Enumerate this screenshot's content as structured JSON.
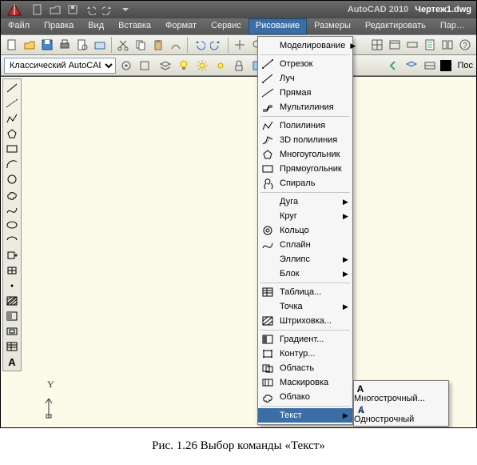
{
  "app": {
    "name": "AutoCAD 2010",
    "filename": "Чертеж1.dwg"
  },
  "menubar": {
    "items": [
      "Файл",
      "Правка",
      "Вид",
      "Вставка",
      "Формат",
      "Сервис",
      "Рисование",
      "Размеры",
      "Редактировать",
      "Параметриза"
    ]
  },
  "workspace": {
    "selected": "Классический AutoCAD"
  },
  "rightlabel": "Пос",
  "dropdown": {
    "groups": [
      [
        {
          "label": "Моделирование",
          "sub": true
        }
      ],
      [
        {
          "label": "Отрезок"
        },
        {
          "label": "Луч"
        },
        {
          "label": "Прямая"
        },
        {
          "label": "Мультилиния"
        }
      ],
      [
        {
          "label": "Полилиния"
        },
        {
          "label": "3D полилиния"
        },
        {
          "label": "Многоугольник"
        },
        {
          "label": "Прямоугольник"
        },
        {
          "label": "Спираль"
        }
      ],
      [
        {
          "label": "Дуга",
          "sub": true
        },
        {
          "label": "Круг",
          "sub": true
        },
        {
          "label": "Кольцо"
        },
        {
          "label": "Сплайн"
        },
        {
          "label": "Эллипс",
          "sub": true
        },
        {
          "label": "Блок",
          "sub": true
        }
      ],
      [
        {
          "label": "Таблица..."
        },
        {
          "label": "Точка",
          "sub": true
        },
        {
          "label": "Штриховка..."
        }
      ],
      [
        {
          "label": "Градиент..."
        },
        {
          "label": "Контур..."
        },
        {
          "label": "Область"
        },
        {
          "label": "Маскировка"
        },
        {
          "label": "Облако"
        }
      ],
      [
        {
          "label": "Текст",
          "sub": true,
          "hl": true
        }
      ]
    ]
  },
  "submenu": {
    "items": [
      {
        "label": "Многострочный..."
      },
      {
        "label": "Однострочный"
      }
    ]
  },
  "caption": "Рис. 1.26 Выбор команды «Текст»"
}
